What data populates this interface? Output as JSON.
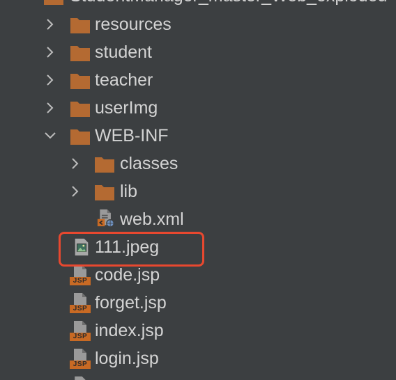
{
  "top_partial_label": "StudentManager_master_Web_exploded",
  "items": [
    {
      "label": "resources",
      "type": "folder",
      "state": "collapsed"
    },
    {
      "label": "student",
      "type": "folder",
      "state": "collapsed"
    },
    {
      "label": "teacher",
      "type": "folder",
      "state": "collapsed"
    },
    {
      "label": "userImg",
      "type": "folder",
      "state": "collapsed"
    },
    {
      "label": "WEB-INF",
      "type": "folder",
      "state": "expanded"
    },
    {
      "label": "classes",
      "type": "folder",
      "state": "collapsed"
    },
    {
      "label": "lib",
      "type": "folder",
      "state": "collapsed"
    },
    {
      "label": "web.xml",
      "type": "xml-file"
    },
    {
      "label": "111.jpeg",
      "type": "image-file",
      "highlighted": true
    },
    {
      "label": "code.jsp",
      "type": "jsp-file"
    },
    {
      "label": "forget.jsp",
      "type": "jsp-file"
    },
    {
      "label": "index.jsp",
      "type": "jsp-file"
    },
    {
      "label": "login.jsp",
      "type": "jsp-file"
    }
  ],
  "jsp_badge_text": "JSP",
  "colors": {
    "background": "#3c3f41",
    "folder": "#b46a32",
    "highlight_border": "#e8482f",
    "text": "#d4d4d4"
  }
}
